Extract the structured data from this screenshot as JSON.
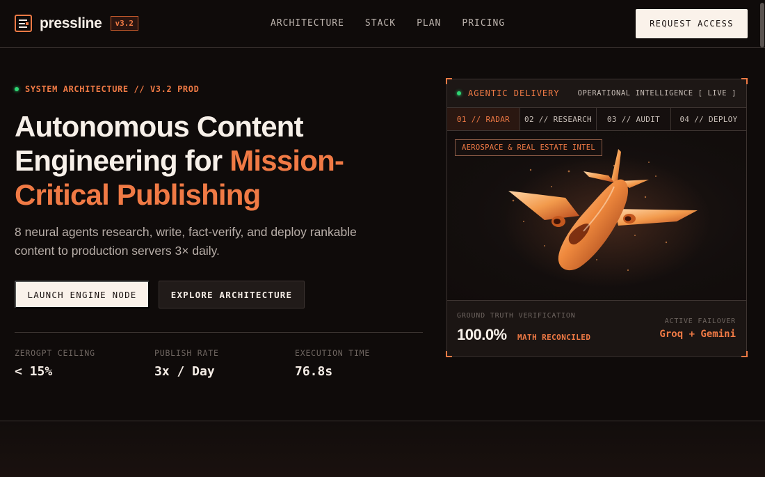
{
  "brand": {
    "name": "pressline",
    "version": "v3.2"
  },
  "nav": {
    "links": [
      "ARCHITECTURE",
      "STACK",
      "PLAN",
      "PRICING"
    ],
    "cta": "REQUEST ACCESS"
  },
  "hero": {
    "eyebrow": "SYSTEM ARCHITECTURE // V3.2 PROD",
    "headline_line1": "Autonomous Content",
    "headline_line2a": "Engineering for ",
    "headline_accent": "Mission-",
    "headline_line3": "Critical Publishing",
    "subtitle": "8 neural agents research, write, fact-verify, and deploy rankable content to production servers 3× daily.",
    "primary_button": "LAUNCH ENGINE NODE",
    "secondary_button": "EXPLORE ARCHITECTURE",
    "stats": [
      {
        "label": "ZEROGPT CEILING",
        "value": "< 15%"
      },
      {
        "label": "PUBLISH RATE",
        "value": "3x / Day"
      },
      {
        "label": "EXECUTION TIME",
        "value": "76.8s"
      }
    ]
  },
  "panel": {
    "title": "AGENTIC DELIVERY",
    "status": "OPERATIONAL INTELLIGENCE [ LIVE ]",
    "tabs": [
      "01 // RADAR",
      "02 // RESEARCH",
      "03 // AUDIT",
      "04 // DEPLOY"
    ],
    "active_tab": 0,
    "viz_tag": "AEROSPACE & REAL ESTATE INTEL",
    "footer": {
      "label": "GROUND TRUTH VERIFICATION",
      "value": "100.0%",
      "value_caption": "MATH RECONCILED",
      "right_label": "ACTIVE FAILOVER",
      "right_value": "Groq + Gemini"
    }
  },
  "colors": {
    "background": "#0f0b0a",
    "accent": "#f07a45",
    "live": "#2ed573",
    "light_button": "#faf2ea"
  },
  "icons": [
    "menu-lines-logo-icon",
    "status-dot-icon",
    "jet-aircraft-illustration"
  ]
}
